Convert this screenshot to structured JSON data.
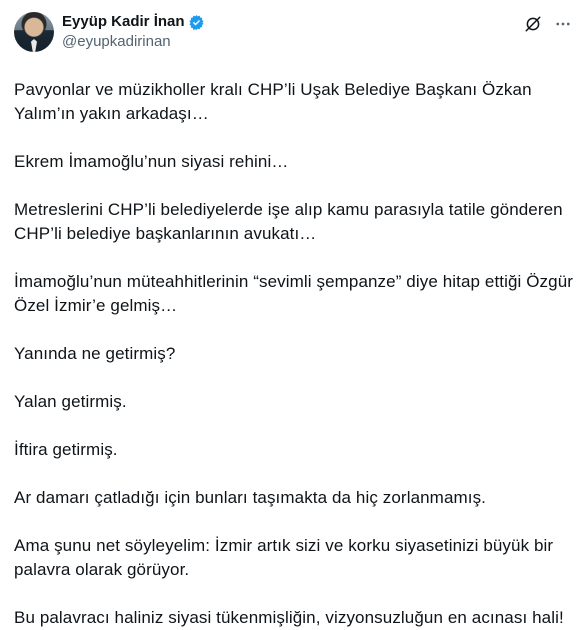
{
  "author": {
    "name": "Eyyüp Kadir İnan",
    "handle": "@eyupkadirinan",
    "verified_icon": "verified-badge-icon",
    "verified_color": "#1d9bf0"
  },
  "actions": {
    "grok_icon": "grok-icon",
    "more_icon": "more-icon"
  },
  "tweet": {
    "paragraphs": [
      "Pavyonlar ve müzikholler kralı CHP’li Uşak Belediye Başkanı Özkan Yalım’ın yakın arkadaşı…",
      "Ekrem İmamoğlu’nun siyasi rehini…",
      "Metreslerini CHP’li belediyelerde işe alıp kamu parasıyla tatile gönderen CHP’li belediye başkanlarının avukatı…",
      "İmamoğlu’nun müteahhitlerinin “sevimli şempanze” diye hitap ettiği Özgür Özel İzmir’e gelmiş…",
      "Yanında ne getirmiş?",
      "Yalan getirmiş.",
      "İftira getirmiş.",
      "Ar damarı çatladığı için bunları taşımakta da hiç zorlanmamış.",
      "Ama şunu net söyleyelim: İzmir artık sizi ve korku siyasetinizi büyük bir palavra olarak görüyor.",
      "Bu palavracı haliniz siyasi tükenmişliğin, vizyonsuzluğun en acınası hali!"
    ]
  },
  "colors": {
    "text": "#0f1419",
    "secondary": "#536471",
    "accent": "#1d9bf0"
  }
}
